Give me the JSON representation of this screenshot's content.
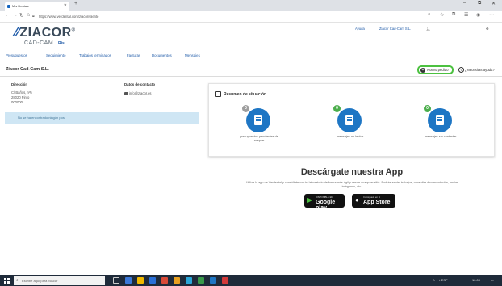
{
  "browser": {
    "tab_title": "Mis Dentale",
    "url": "https://www.verdental.com/ziacor/cliente",
    "window_controls": [
      "–",
      "⧉",
      "✕"
    ]
  },
  "site": {
    "logo": "ZIACOR",
    "logo_sub": "CAD-CAM",
    "logo_brand2": "Ris",
    "header_links": [
      "Ayuda",
      "Ziacor Cad-Cam S.L."
    ],
    "nav": [
      "Presupuestos",
      "Seguimiento",
      "Trabajos terminados",
      "Facturas",
      "Documentos",
      "Mensajes"
    ]
  },
  "company": {
    "name": "Ziacor Cad-Cam S.L.",
    "new_order_label": "Nuevo pedido",
    "help_label": "¿Necesitas ayuda?"
  },
  "direccion": {
    "label": "Dirección",
    "lines": [
      "C/ Baños, nº5",
      "28020 Pinto",
      "000000"
    ]
  },
  "contacto": {
    "label": "Datos de contacto",
    "email": "info@ziacor.es"
  },
  "info_bar": "No se ha encontrado ningún post",
  "resumen": {
    "title": "Resumen de situación",
    "stats": [
      {
        "count": "0",
        "label": "presupuestos pendientes de aceptar",
        "badge_color": "#9e9e9e"
      },
      {
        "count": "0",
        "label": "mensajes no leídos",
        "badge_color": "#4cae4c"
      },
      {
        "count": "0",
        "label": "mensajes sin contestar",
        "badge_color": "#4cae4c"
      }
    ]
  },
  "app": {
    "title": "Descárgate nuestra App",
    "description": "Utiliza la app de Verdental y consúltate con tu laboratorio de forma más ágil y desde cualquier sitio. Podrás enviar trabajos, consultar documentación, enviar imágenes, etc.",
    "google_small": "DISPONIBLE EN",
    "google_big": "Google play",
    "apple_small": "Consíguelo en el",
    "apple_big": "App Store"
  },
  "taskbar": {
    "search_placeholder": "Escribe aquí para buscar",
    "tray_text": "∧ ◔ ♪ ESP",
    "clock": "10:00"
  }
}
